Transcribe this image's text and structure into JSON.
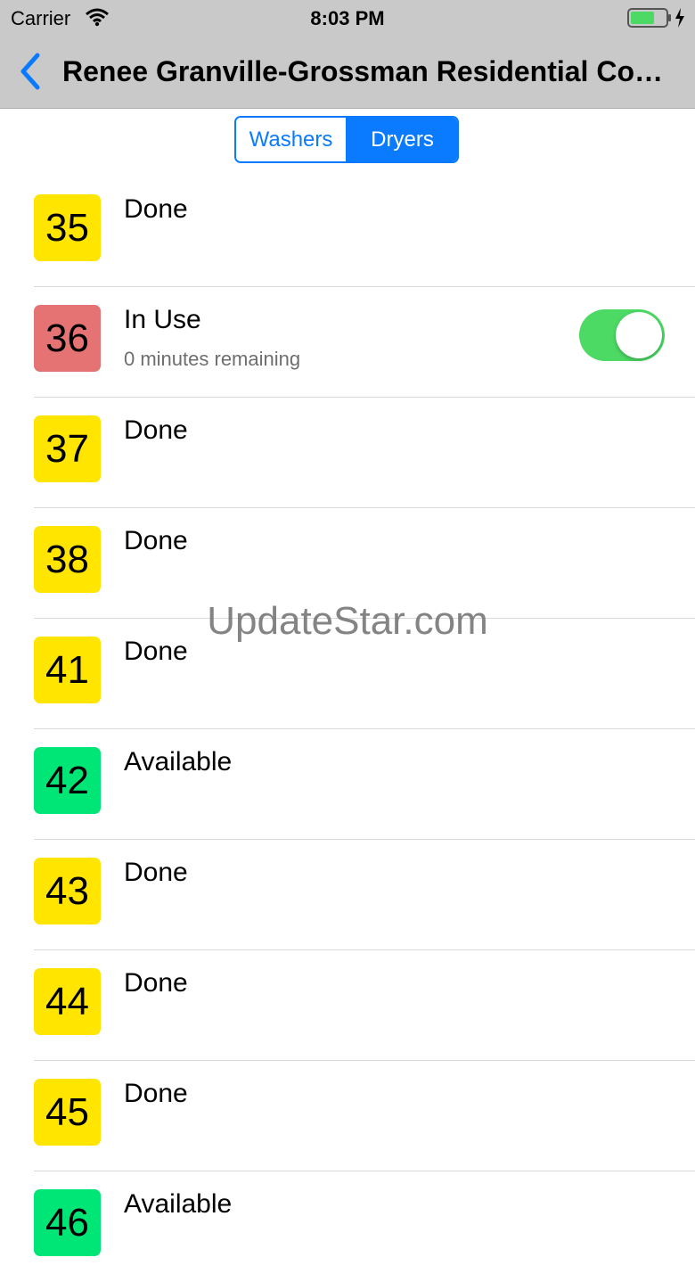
{
  "status_bar": {
    "carrier": "Carrier",
    "time": "8:03 PM",
    "icons": [
      "wifi-icon",
      "battery-charging-icon"
    ]
  },
  "nav": {
    "title": "Renee Granville-Grossman Residential Com...",
    "back_icon": "chevron-left-icon"
  },
  "segments": [
    {
      "label": "Washers",
      "selected": false
    },
    {
      "label": "Dryers",
      "selected": true
    }
  ],
  "colors": {
    "accent": "#0a7aff",
    "done": "#ffe500",
    "in_use": "#e57373",
    "available": "#00e676",
    "toggle_on": "#4cd964"
  },
  "machines": [
    {
      "number": "35",
      "status": "Done",
      "color": "#ffe500"
    },
    {
      "number": "36",
      "status": "In Use",
      "detail": "0 minutes remaining",
      "color": "#e57373",
      "notify": true
    },
    {
      "number": "37",
      "status": "Done",
      "color": "#ffe500"
    },
    {
      "number": "38",
      "status": "Done",
      "color": "#ffe500"
    },
    {
      "number": "41",
      "status": "Done",
      "color": "#ffe500"
    },
    {
      "number": "42",
      "status": "Available",
      "color": "#00e676"
    },
    {
      "number": "43",
      "status": "Done",
      "color": "#ffe500"
    },
    {
      "number": "44",
      "status": "Done",
      "color": "#ffe500"
    },
    {
      "number": "45",
      "status": "Done",
      "color": "#ffe500"
    },
    {
      "number": "46",
      "status": "Available",
      "color": "#00e676"
    }
  ],
  "watermark": "UpdateStar.com"
}
